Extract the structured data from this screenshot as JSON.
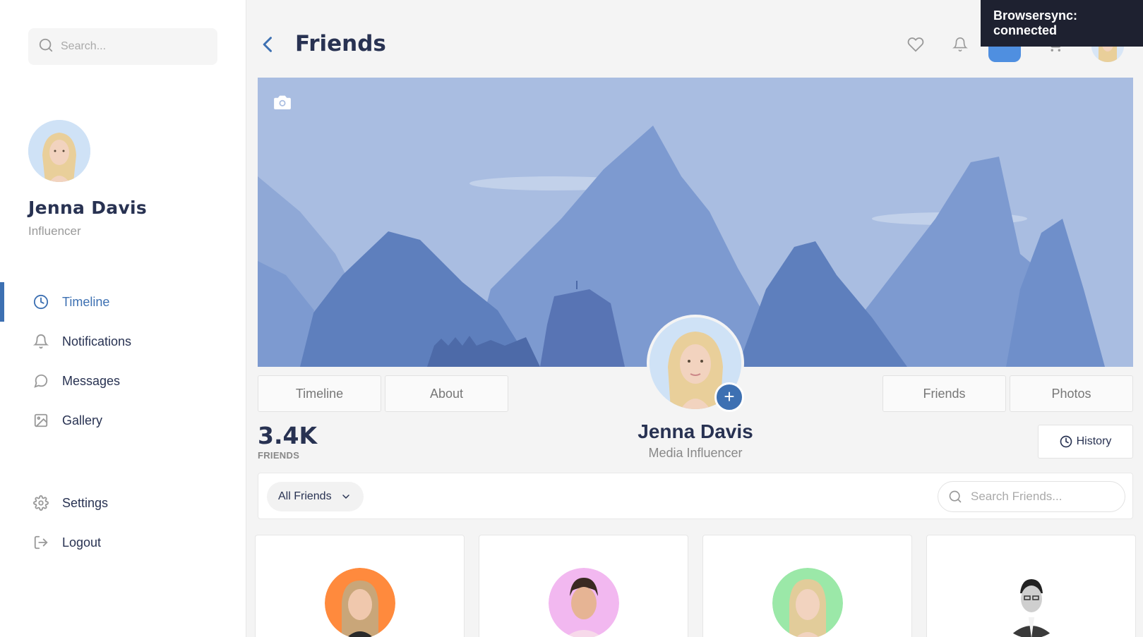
{
  "sidebar": {
    "search_placeholder": "Search...",
    "user": {
      "name": "Jenna Davis",
      "role": "Influencer"
    },
    "nav": [
      {
        "label": "Timeline",
        "icon": "clock-icon",
        "active": true
      },
      {
        "label": "Notifications",
        "icon": "bell-icon"
      },
      {
        "label": "Messages",
        "icon": "chat-icon"
      },
      {
        "label": "Gallery",
        "icon": "image-icon"
      },
      {
        "label": "Settings",
        "icon": "gear-icon"
      },
      {
        "label": "Logout",
        "icon": "logout-icon"
      }
    ]
  },
  "header": {
    "title": "Friends",
    "icons": [
      "heart-icon",
      "bell-icon",
      "app-icon",
      "cart-icon",
      "avatar"
    ]
  },
  "toast": {
    "text": "Browsersync: connected"
  },
  "profile": {
    "name": "Jenna Davis",
    "role": "Media Influencer",
    "stat_value": "3.4K",
    "stat_label": "FRIENDS",
    "tabs_left": [
      "Timeline",
      "About"
    ],
    "tabs_right": [
      "Friends",
      "Photos"
    ],
    "history_label": "History",
    "add_label": "+"
  },
  "filter": {
    "selected": "All Friends",
    "search_placeholder": "Search Friends..."
  },
  "friends": [
    {
      "avatar_bg": "#ff8a3d"
    },
    {
      "avatar_bg": "#f2b8f0"
    },
    {
      "avatar_bg": "#9be8a8"
    },
    {
      "avatar_bg": "#ffffff"
    }
  ],
  "colors": {
    "accent": "#3d70b2",
    "title": "#283252",
    "cover": "#a9bde1",
    "toast_bg": "#1e2130"
  }
}
